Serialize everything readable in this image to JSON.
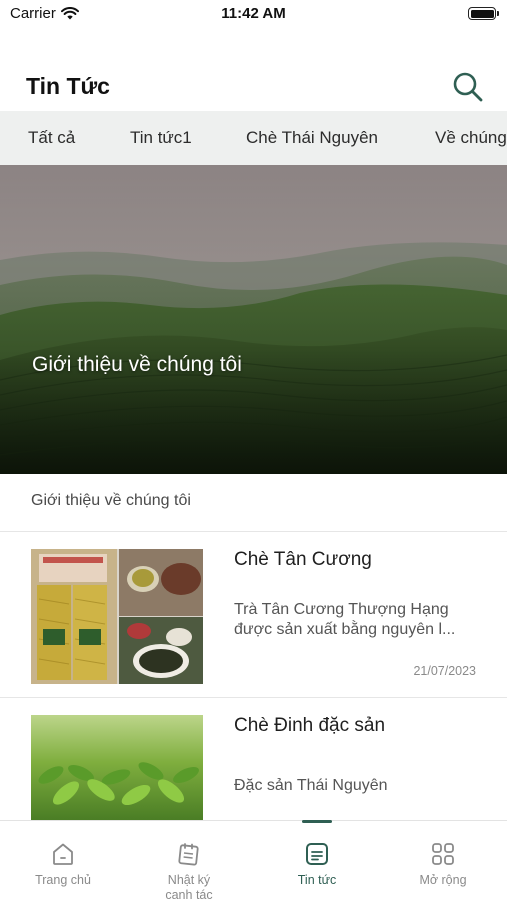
{
  "status_bar": {
    "carrier": "Carrier",
    "time": "11:42 AM"
  },
  "header": {
    "title": "Tin Tức"
  },
  "tabs": [
    {
      "label": "Tất cả"
    },
    {
      "label": "Tin tức1"
    },
    {
      "label": "Chè Thái Nguyên"
    },
    {
      "label": "Về chúng"
    }
  ],
  "hero": {
    "title": "Giới thiệu về chúng tôi"
  },
  "section": {
    "label": "Giới thiệu về chúng tôi"
  },
  "news": [
    {
      "title": "Chè Tân Cương",
      "excerpt": "Trà Tân Cương Thượng Hạng được sản xuất bằng nguyên l...",
      "date": "21/07/2023"
    },
    {
      "title": "Chè Đinh đặc sản",
      "excerpt": "Đặc sản Thái Nguyên",
      "date": ""
    }
  ],
  "tabbar": [
    {
      "label": "Trang chủ",
      "icon": "home-icon",
      "active": false
    },
    {
      "label": "Nhật ký canh tác",
      "icon": "journal-icon",
      "active": false
    },
    {
      "label": "Tin tức",
      "icon": "news-icon",
      "active": true
    },
    {
      "label": "Mở rộng",
      "icon": "grid-icon",
      "active": false
    }
  ],
  "colors": {
    "accent": "#2f5f53",
    "tab_bg": "#eef0ef",
    "muted": "#8a8a8a"
  }
}
